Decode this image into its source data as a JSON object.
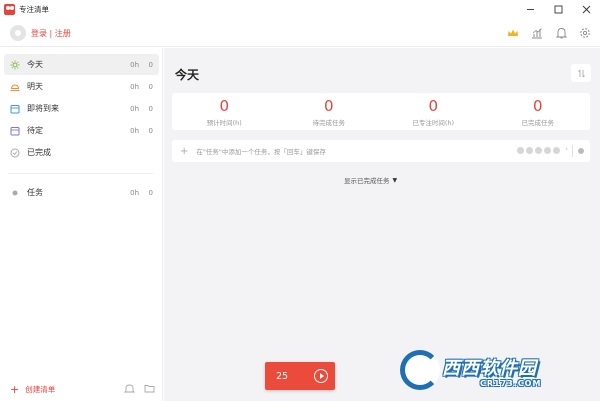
{
  "window": {
    "title": "专注清单",
    "controls": [
      "minimize",
      "maximize",
      "close"
    ]
  },
  "header": {
    "login_text": "登录 | 注册",
    "icons": [
      "crown-icon",
      "stats-icon",
      "bell-icon",
      "settings-icon"
    ],
    "accent_color": "#e8433a"
  },
  "sidebar": {
    "items": [
      {
        "label": "今天",
        "hours": "0h",
        "count": "0",
        "icon": "sun-icon",
        "active": true
      },
      {
        "label": "明天",
        "hours": "0h",
        "count": "0",
        "icon": "sunrise-icon"
      },
      {
        "label": "即将到来",
        "hours": "0h",
        "count": "0",
        "icon": "calendar-upcoming-icon"
      },
      {
        "label": "待定",
        "hours": "0h",
        "count": "0",
        "icon": "calendar-pending-icon"
      },
      {
        "label": "已完成",
        "icon": "check-circle-icon"
      }
    ],
    "lists": [
      {
        "label": "任务",
        "hours": "0h",
        "count": "0",
        "icon": "dot-icon"
      }
    ],
    "footer": {
      "create_label": "创建清单"
    }
  },
  "main": {
    "title": "今天",
    "stats": [
      {
        "value": "0",
        "label": "预计时间(h)"
      },
      {
        "value": "0",
        "label": "待完成任务"
      },
      {
        "value": "0",
        "label": "已专注时间(h)"
      },
      {
        "value": "0",
        "label": "已完成任务"
      }
    ],
    "add_task_placeholder": "在\"任务\"中添加一个任务，按「回车」键保存",
    "show_completed_label": "显示已完成任务"
  },
  "pomodoro": {
    "minutes": "25"
  },
  "watermark": {
    "text": "西西软件园",
    "url": "CR173.COM"
  }
}
